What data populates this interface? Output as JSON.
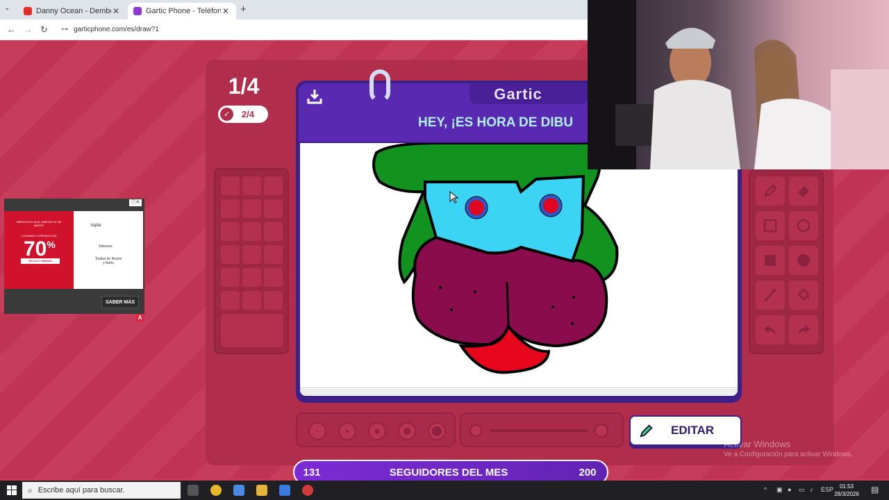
{
  "browser": {
    "tabs": [
      {
        "title": "Danny Ocean - Dembow (O",
        "favicon_color": "#e52d27"
      },
      {
        "title": "Gartic Phone - Teléfono Descon",
        "favicon_color": "#8e3ad1"
      }
    ],
    "url": "garticphone.com/es/draw?1"
  },
  "game": {
    "round": "1/4",
    "done_count": "2/4",
    "logo": "Gartic",
    "prompt": "HEY, ¡ES HORA DE DIBU",
    "edit_label": "EDITAR",
    "colors": {
      "accent": "#5a29b1",
      "background": "#c43555"
    }
  },
  "drawing": {
    "hair": "#12921e",
    "mask": "#3cd4f5",
    "eye_ring": "#2b57c9",
    "eye": "#e0061f",
    "face": "#8b0c4c",
    "tongue": "#e8061c"
  },
  "followers_bar": {
    "current": "131",
    "label": "SEGUIDORES DEL MES",
    "goal": "200"
  },
  "ad": {
    "header_text": "MIÉRCOLES 26 AL MARTES 31 DE MARZO",
    "offer_text": "LLEVANDO 2 PRODUCTOS",
    "percent": "70",
    "percent_sign": "%",
    "band_text": "EN LA 2ª UNIDAD",
    "category_title": "Vajilla",
    "items": [
      "Sábanas",
      "Toallas de Rostro y Baño"
    ],
    "cta": "SABER MÁS",
    "badge": "A"
  },
  "watermark": {
    "line1": "Activar Windows",
    "line2": "Ve a Configuración para activar Windows."
  },
  "taskbar": {
    "search_placeholder": "Escribe aquí para buscar.",
    "lang": "ESP",
    "time": "01:53",
    "date": "28/3/2026"
  }
}
